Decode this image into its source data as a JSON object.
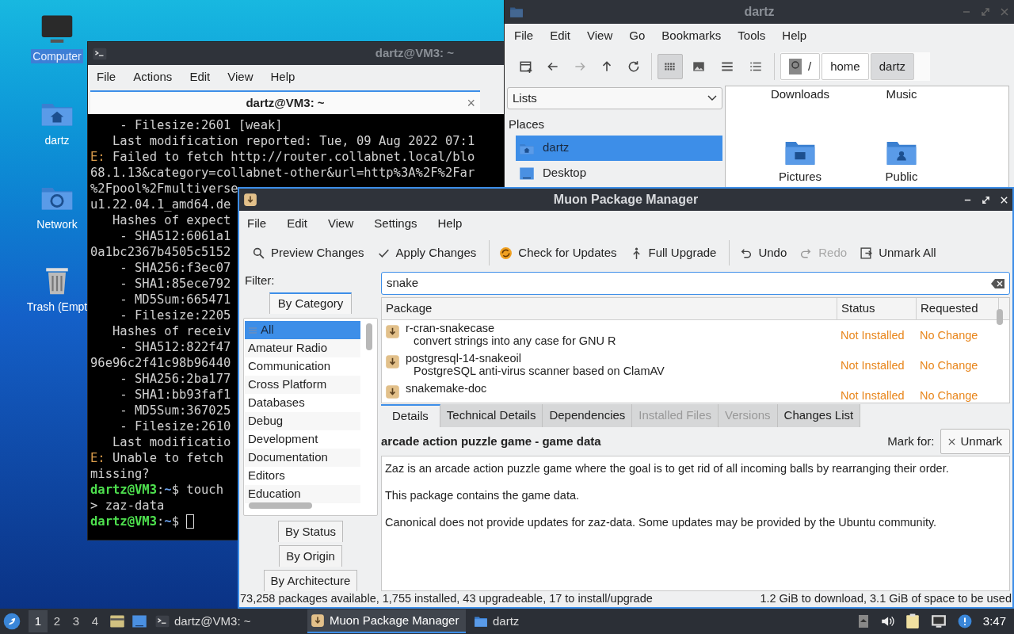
{
  "desktop_icons": [
    {
      "label": "Computer",
      "kind": "computer",
      "selected": true
    },
    {
      "label": "dartz",
      "kind": "home",
      "selected": false
    },
    {
      "label": "Network",
      "kind": "network",
      "selected": false
    },
    {
      "label": "Trash (Empt",
      "kind": "trash",
      "selected": false
    }
  ],
  "terminal": {
    "title": "dartz@VM3: ~",
    "menu": [
      "File",
      "Actions",
      "Edit",
      "View",
      "Help"
    ],
    "tab": {
      "label": "dartz@VM3: ~",
      "close": "×"
    },
    "lines": [
      {
        "segments": [
          {
            "kind": "plain",
            "text": "    - Filesize:2601 [weak]"
          }
        ]
      },
      {
        "segments": [
          {
            "kind": "plain",
            "text": "   Last modification reported: Tue, 09 Aug 2022 07:1"
          }
        ]
      },
      {
        "segments": [
          {
            "kind": "error",
            "text": "E:"
          },
          {
            "kind": "plain",
            "text": " Failed to fetch http://router.collabnet.local/blo"
          }
        ]
      },
      {
        "segments": [
          {
            "kind": "plain",
            "text": "68.1.13&category=collabnet-other&url=http%3A%2F%2Far"
          }
        ]
      },
      {
        "segments": [
          {
            "kind": "plain",
            "text": "%2Fpool%2Fmultiverse"
          }
        ]
      },
      {
        "segments": [
          {
            "kind": "plain",
            "text": "u1.22.04.1_amd64.de"
          }
        ]
      },
      {
        "segments": [
          {
            "kind": "plain",
            "text": "   Hashes of expect"
          }
        ]
      },
      {
        "segments": [
          {
            "kind": "plain",
            "text": "    - SHA512:6061a1"
          }
        ]
      },
      {
        "segments": [
          {
            "kind": "plain",
            "text": "0a1bc2367b4505c5152"
          }
        ]
      },
      {
        "segments": [
          {
            "kind": "plain",
            "text": "    - SHA256:f3ec07"
          }
        ]
      },
      {
        "segments": [
          {
            "kind": "plain",
            "text": "    - SHA1:85ece792"
          }
        ]
      },
      {
        "segments": [
          {
            "kind": "plain",
            "text": "    - MD5Sum:665471"
          }
        ]
      },
      {
        "segments": [
          {
            "kind": "plain",
            "text": "    - Filesize:2205"
          }
        ]
      },
      {
        "segments": [
          {
            "kind": "plain",
            "text": "   Hashes of receiv"
          }
        ]
      },
      {
        "segments": [
          {
            "kind": "plain",
            "text": "    - SHA512:822f47"
          }
        ]
      },
      {
        "segments": [
          {
            "kind": "plain",
            "text": "96e96c2f41c98b96440"
          }
        ]
      },
      {
        "segments": [
          {
            "kind": "plain",
            "text": "    - SHA256:2ba177"
          }
        ]
      },
      {
        "segments": [
          {
            "kind": "plain",
            "text": "    - SHA1:bb93faf1"
          }
        ]
      },
      {
        "segments": [
          {
            "kind": "plain",
            "text": "    - MD5Sum:367025"
          }
        ]
      },
      {
        "segments": [
          {
            "kind": "plain",
            "text": "    - Filesize:2610"
          }
        ]
      },
      {
        "segments": [
          {
            "kind": "plain",
            "text": "   Last modificatio"
          }
        ]
      },
      {
        "segments": [
          {
            "kind": "error",
            "text": "E:"
          },
          {
            "kind": "plain",
            "text": " Unable to fetch"
          }
        ]
      },
      {
        "segments": [
          {
            "kind": "plain",
            "text": "missing?"
          }
        ]
      },
      {
        "segments": [
          {
            "kind": "user",
            "text": "dartz@VM3"
          },
          {
            "kind": "plain",
            "text": ":"
          },
          {
            "kind": "path",
            "text": "~"
          },
          {
            "kind": "plain",
            "text": "$ touch"
          }
        ]
      },
      {
        "segments": [
          {
            "kind": "plain",
            "text": "> zaz-data"
          }
        ]
      },
      {
        "segments": [
          {
            "kind": "user",
            "text": "dartz@VM3"
          },
          {
            "kind": "plain",
            "text": ":"
          },
          {
            "kind": "path",
            "text": "~"
          },
          {
            "kind": "plain",
            "text": "$ "
          }
        ],
        "cursor": true
      }
    ]
  },
  "file_manager": {
    "title": "dartz",
    "menu": [
      "File",
      "Edit",
      "View",
      "Go",
      "Bookmarks",
      "Tools",
      "Help"
    ],
    "view_modes": [
      {
        "kind": "icons",
        "selected": true
      },
      {
        "kind": "thumbnails",
        "selected": false
      },
      {
        "kind": "compact",
        "selected": false
      },
      {
        "kind": "details",
        "selected": false
      }
    ],
    "path": [
      {
        "label": "/",
        "kind": "root",
        "selected": false
      },
      {
        "label": "home",
        "kind": "dir",
        "selected": false
      },
      {
        "label": "dartz",
        "kind": "dir",
        "selected": true
      }
    ],
    "side_dropdown": "Lists",
    "places_heading": "Places",
    "places": [
      {
        "label": "dartz",
        "kind": "home",
        "selected": true
      },
      {
        "label": "Desktop",
        "kind": "desktop",
        "selected": false
      }
    ],
    "files": [
      {
        "label": "Downloads",
        "kind": "hidden"
      },
      {
        "label": "Music",
        "kind": "hidden"
      },
      {
        "label": "Pictures",
        "kind": "pictures"
      },
      {
        "label": "Public",
        "kind": "public"
      }
    ]
  },
  "muon": {
    "title": "Muon Package Manager",
    "menu": [
      "File",
      "Edit",
      "View",
      "Settings",
      "Help"
    ],
    "toolbar_groups": [
      [
        {
          "label": "Preview Changes",
          "kind": "search",
          "disabled": false
        },
        {
          "label": "Apply Changes",
          "kind": "check",
          "disabled": false
        }
      ],
      [
        {
          "label": "Check for Updates",
          "kind": "refresh",
          "disabled": false
        },
        {
          "label": "Full Upgrade",
          "kind": "upgrade",
          "disabled": false
        }
      ],
      [
        {
          "label": "Undo",
          "kind": "undo",
          "disabled": false
        },
        {
          "label": "Redo",
          "kind": "redo",
          "disabled": true
        },
        {
          "label": "Unmark All",
          "kind": "unmark",
          "disabled": false
        }
      ]
    ],
    "filter_label": "Filter:",
    "filter_tabs": [
      {
        "label": "By Category",
        "selected": true
      },
      {
        "label": "By Status",
        "selected": false
      },
      {
        "label": "By Origin",
        "selected": false
      },
      {
        "label": "By Architecture",
        "selected": false
      }
    ],
    "categories": [
      {
        "label": "All",
        "selected": true
      },
      {
        "label": "Amateur Radio",
        "selected": false
      },
      {
        "label": "Communication",
        "selected": false
      },
      {
        "label": "Cross Platform",
        "selected": false
      },
      {
        "label": "Databases",
        "selected": false
      },
      {
        "label": "Debug",
        "selected": false
      },
      {
        "label": "Development",
        "selected": false
      },
      {
        "label": "Documentation",
        "selected": false
      },
      {
        "label": "Editors",
        "selected": false
      },
      {
        "label": "Education",
        "selected": false
      }
    ],
    "search": {
      "value": "snake"
    },
    "table": {
      "columns": [
        "Package",
        "Status",
        "Requested"
      ],
      "rows": [
        {
          "name": "r-cran-snakecase",
          "description": "convert strings into any case for GNU R",
          "status": "Not Installed",
          "requested": "No Change"
        },
        {
          "name": "postgresql-14-snakeoil",
          "description": "PostgreSQL anti-virus scanner based on ClamAV",
          "status": "Not Installed",
          "requested": "No Change"
        },
        {
          "name": "snakemake-doc",
          "status": "Not Installed",
          "requested": "No Change"
        }
      ]
    },
    "detail_tabs": [
      {
        "label": "Details",
        "selected": true,
        "disabled": false
      },
      {
        "label": "Technical Details",
        "selected": false,
        "disabled": false
      },
      {
        "label": "Dependencies",
        "selected": false,
        "disabled": false
      },
      {
        "label": "Installed Files",
        "selected": false,
        "disabled": true
      },
      {
        "label": "Versions",
        "selected": false,
        "disabled": true
      },
      {
        "label": "Changes List",
        "selected": false,
        "disabled": false
      }
    ],
    "detail": {
      "heading": "arcade action puzzle game - game data",
      "mark_label": "Mark for:",
      "mark_button": "Unmark",
      "paragraphs": [
        "Zaz is an arcade action puzzle game where the goal is to get rid of all incoming balls by rearranging their order.",
        "This package contains the game data.",
        "Canonical does not provide updates for zaz-data. Some updates may be provided by the Ubuntu community."
      ]
    },
    "status_left": "73,258 packages available, 1,755 installed, 43 upgradeable, 17 to install/upgrade",
    "status_right": "1.2 GiB to download, 3.1 GiB of space to be used"
  },
  "taskbar": {
    "workspaces": [
      {
        "label": "1",
        "selected": true
      },
      {
        "label": "2",
        "selected": false
      },
      {
        "label": "3",
        "selected": false
      },
      {
        "label": "4",
        "selected": false
      }
    ],
    "tasks": [
      {
        "label": "dartz@VM3: ~",
        "kind": "terminal",
        "selected": false
      },
      {
        "label": "Muon Package Manager",
        "kind": "package",
        "selected": true
      },
      {
        "label": "dartz",
        "kind": "folder",
        "selected": false
      }
    ],
    "clock": "3:47"
  }
}
